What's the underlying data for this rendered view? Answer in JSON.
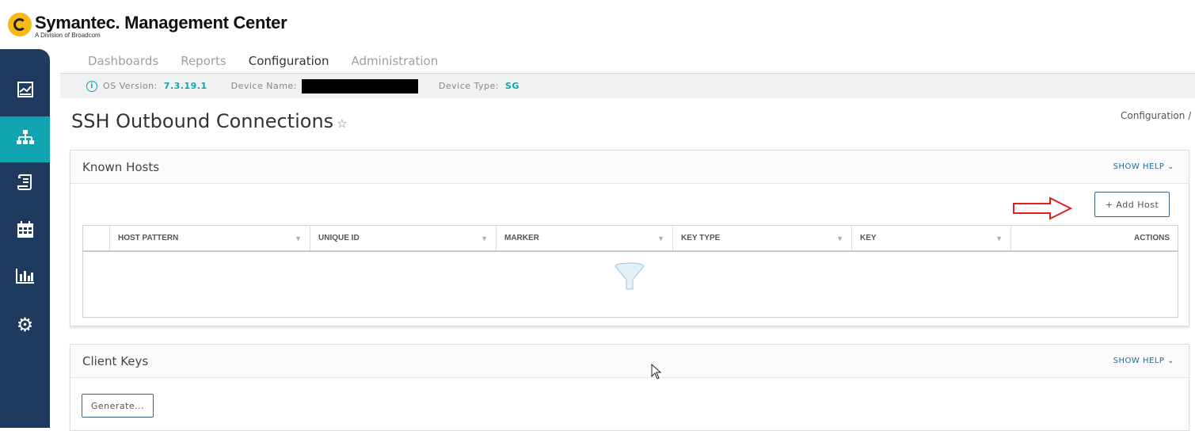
{
  "brand": {
    "title": "Symantec. Management Center",
    "subtitle": "A Division of Broadcom"
  },
  "sidebar": {
    "items": [
      {
        "icon": "dashboard-icon"
      },
      {
        "icon": "hierarchy-icon",
        "active": true
      },
      {
        "icon": "scroll-icon"
      },
      {
        "icon": "calendar-icon"
      },
      {
        "icon": "bar-chart-icon"
      },
      {
        "icon": "gear-icon"
      }
    ]
  },
  "tabs": [
    "Dashboards",
    "Reports",
    "Configuration",
    "Administration"
  ],
  "active_tab": "Configuration",
  "infobar": {
    "os_label": "OS Version:",
    "os_value": "7.3.19.1",
    "device_name_label": "Device Name:",
    "device_type_label": "Device Type:",
    "device_type_value": "SG"
  },
  "page": {
    "title": "SSH Outbound Connections",
    "breadcrumb": "Configuration /"
  },
  "known_hosts": {
    "title": "Known Hosts",
    "show_help": "SHOW HELP",
    "add_button": "+ Add Host",
    "columns": [
      "HOST PATTERN",
      "UNIQUE ID",
      "MARKER",
      "KEY TYPE",
      "KEY",
      "ACTIONS"
    ],
    "rows": []
  },
  "client_keys": {
    "title": "Client Keys",
    "show_help": "SHOW HELP",
    "generate_button": "Generate..."
  }
}
